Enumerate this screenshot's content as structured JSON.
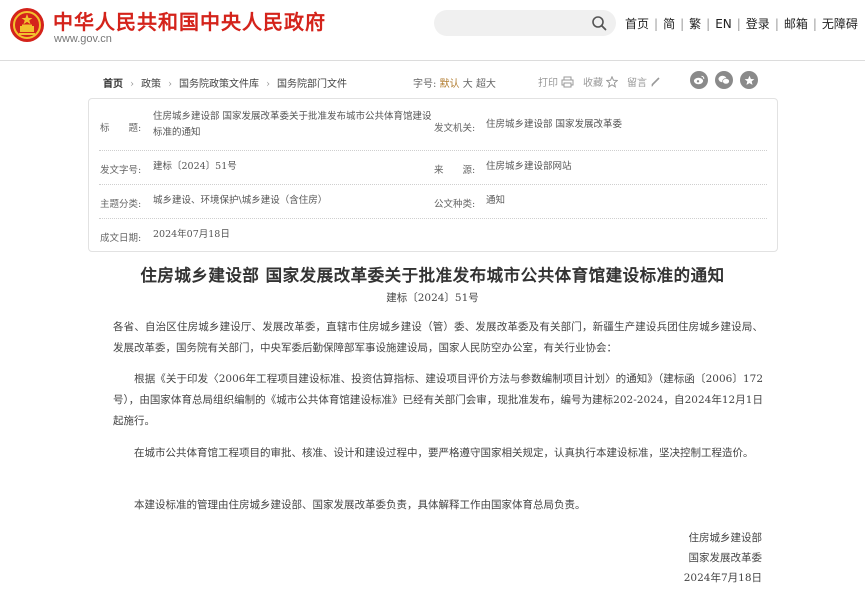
{
  "header": {
    "site_title": "中华人民共和国中央人民政府",
    "site_url": "www.gov.cn",
    "search_placeholder": "",
    "nav": [
      {
        "label": "首页"
      },
      {
        "label": "简"
      },
      {
        "label": "繁"
      },
      {
        "label": "EN"
      },
      {
        "label": "登录"
      },
      {
        "label": "邮箱"
      },
      {
        "label": "无障碍"
      }
    ]
  },
  "breadcrumb": [
    "首页",
    "政策",
    "国务院政策文件库",
    "国务院部门文件"
  ],
  "font_size": {
    "label": "字号:",
    "options": [
      "默认",
      "大",
      "超大"
    ],
    "selected": "默认"
  },
  "tools": {
    "print": "打印",
    "favorite": "收藏",
    "comment": "留言"
  },
  "info": {
    "title_label": "标　　题:",
    "title_value": "住房城乡建设部 国家发展改革委关于批准发布城市公共体育馆建设标准的通知",
    "issuer_label": "发文机关:",
    "issuer_value": "住房城乡建设部  国家发展改革委",
    "docno_label": "发文字号:",
    "docno_value": "建标〔2024〕51号",
    "source_label": "来　　源:",
    "source_value": "住房城乡建设部网站",
    "category_label": "主题分类:",
    "category_value": "城乡建设、环境保护\\城乡建设（含住房）",
    "type_label": "公文种类:",
    "type_value": "通知",
    "date_label": "成文日期:",
    "date_value": "2024年07月18日"
  },
  "article": {
    "title": "住房城乡建设部  国家发展改革委关于批准发布城市公共体育馆建设标准的通知",
    "docno": "建标〔2024〕51号",
    "p1": "各省、自治区住房城乡建设厅、发展改革委，直辖市住房城乡建设（管）委、发展改革委及有关部门，新疆生产建设兵团住房城乡建设局、发展改革委，国务院有关部门，中央军委后勤保障部军事设施建设局，国家人民防空办公室，有关行业协会：",
    "p2": "　　根据《关于印发〈2006年工程项目建设标准、投资估算指标、建设项目评价方法与参数编制项目计划〉的通知》（建标函〔2006〕172号），由国家体育总局组织编制的《城市公共体育馆建设标准》已经有关部门会审，现批准发布，编号为建标202-2024，自2024年12月1日起施行。",
    "p3": "　　在城市公共体育馆工程项目的审批、核准、设计和建设过程中，要严格遵守国家相关规定，认真执行本建设标准，坚决控制工程造价。",
    "p4": "　　本建设标准的管理由住房城乡建设部、国家发展改革委负责，具体解释工作由国家体育总局负责。",
    "sign1": "住房城乡建设部",
    "sign2": "国家发展改革委",
    "sign_date": "2024年7月18日"
  },
  "colors": {
    "brand_red": "#d4231b",
    "accent_gold": "#b07a2c"
  }
}
